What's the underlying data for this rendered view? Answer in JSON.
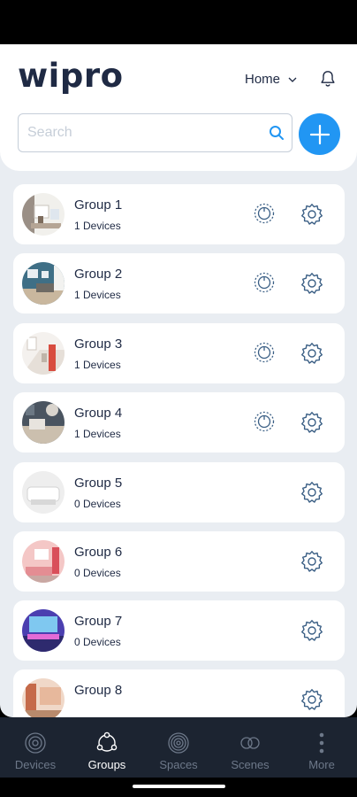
{
  "app": {
    "logo": "wipro"
  },
  "header": {
    "home_label": "Home"
  },
  "search": {
    "placeholder": "Search"
  },
  "groups": [
    {
      "name": "Group 1",
      "devices": "1 Devices",
      "has_light_control": true
    },
    {
      "name": "Group 2",
      "devices": "1 Devices",
      "has_light_control": true
    },
    {
      "name": "Group 3",
      "devices": "1 Devices",
      "has_light_control": true
    },
    {
      "name": "Group 4",
      "devices": "1 Devices",
      "has_light_control": true
    },
    {
      "name": "Group 5",
      "devices": "0 Devices",
      "has_light_control": false
    },
    {
      "name": "Group 6",
      "devices": "0 Devices",
      "has_light_control": false
    },
    {
      "name": "Group 7",
      "devices": "0 Devices",
      "has_light_control": false
    },
    {
      "name": "Group 8",
      "devices": "",
      "has_light_control": false
    }
  ],
  "nav": {
    "items": [
      {
        "label": "Devices",
        "icon": "devices-icon",
        "active": false
      },
      {
        "label": "Groups",
        "icon": "groups-icon",
        "active": true
      },
      {
        "label": "Spaces",
        "icon": "spaces-icon",
        "active": false
      },
      {
        "label": "Scenes",
        "icon": "scenes-icon",
        "active": false
      },
      {
        "label": "More",
        "icon": "more-icon",
        "active": false
      }
    ]
  },
  "colors": {
    "accent": "#2196f3",
    "text": "#1f2a44",
    "nav_bg": "#1c2431",
    "icon": "#3b5f85"
  }
}
